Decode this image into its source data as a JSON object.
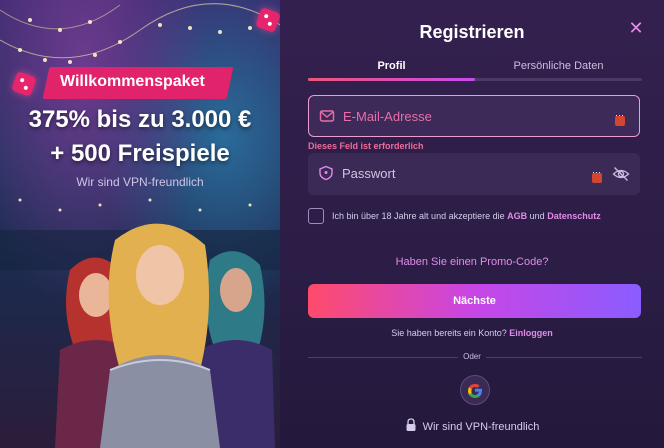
{
  "promo": {
    "badge": "Willkommenspaket",
    "headline_line1": "375% bis zu 3.000 €",
    "headline_line2": "+ 500 Freispiele",
    "vpn_note": "Wir sind VPN-freundlich"
  },
  "modal": {
    "title": "Registrieren",
    "tabs": [
      {
        "label": "Profil",
        "active": true
      },
      {
        "label": "Persönliche Daten",
        "active": false
      }
    ],
    "email": {
      "placeholder": "E-Mail-Adresse",
      "value": ""
    },
    "error": "Dieses Feld ist erforderlich",
    "password": {
      "placeholder": "Passwort",
      "value": ""
    },
    "terms": {
      "text": "Ich bin über 18 Jahre alt und akzeptiere die",
      "agb": "AGB",
      "and": "und",
      "privacy": "Datenschutz",
      "checked": false
    },
    "promo_code_link": "Haben Sie einen Promo-Code?",
    "next_button": "Nächste",
    "account_prompt": "Sie haben bereits ein Konto?",
    "login_link": "Einloggen",
    "or_label": "Oder",
    "vpn_note": "Wir sind VPN-freundlich"
  },
  "colors": {
    "accent_pink": "#e18ce7",
    "error": "#ef6b9a",
    "button_start": "#ff4a6b",
    "button_end": "#8a5cff",
    "badge": "#e0236a"
  },
  "icons": [
    "close-icon",
    "mail-icon",
    "shield-icon",
    "key-icon",
    "eye-off-icon",
    "google-icon",
    "lock-icon"
  ]
}
